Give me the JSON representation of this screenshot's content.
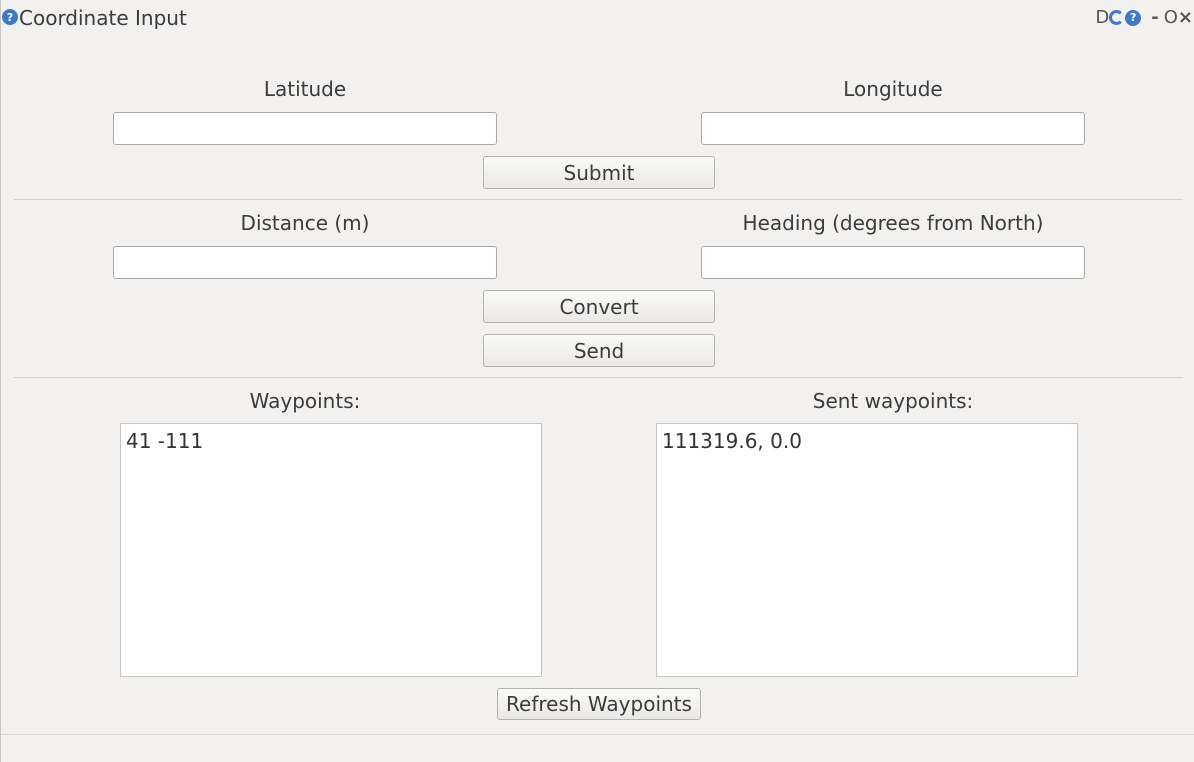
{
  "window": {
    "title": "Coordinate Input",
    "controls": {
      "d_label": "D",
      "help": "?",
      "minimize": "-",
      "maximize": "O",
      "close": "×"
    },
    "help_icon": "?"
  },
  "coordinates": {
    "latitude_label": "Latitude",
    "longitude_label": "Longitude",
    "latitude_value": "",
    "longitude_value": "",
    "submit_label": "Submit"
  },
  "offset": {
    "distance_label": "Distance (m)",
    "heading_label": "Heading (degrees from North)",
    "distance_value": "",
    "heading_value": "",
    "convert_label": "Convert",
    "send_label": "Send"
  },
  "waypoints": {
    "label": "Waypoints:",
    "items": [
      "41 -111"
    ]
  },
  "sent_waypoints": {
    "label": "Sent waypoints:",
    "items": [
      "111319.6, 0.0"
    ]
  },
  "refresh_label": "Refresh Waypoints",
  "colors": {
    "background": "#f2f1f0",
    "accent_icon": "#3d78c9"
  }
}
